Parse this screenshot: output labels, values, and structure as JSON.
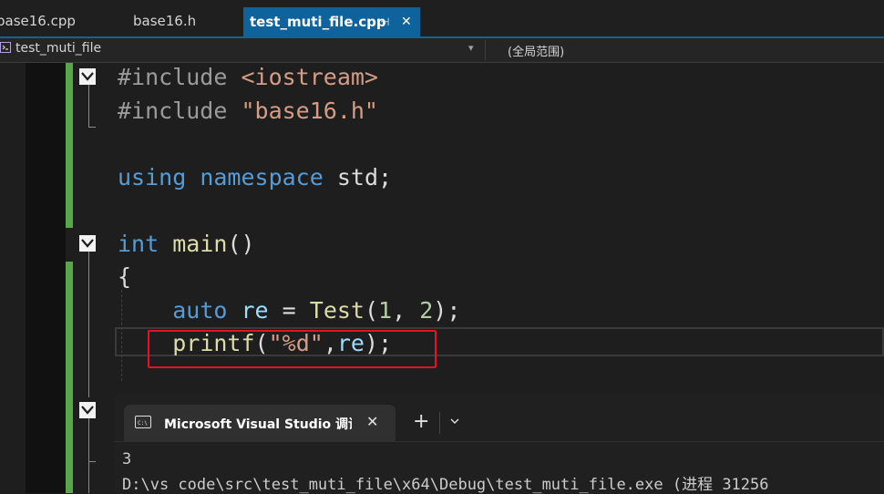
{
  "tabs": [
    {
      "label": "base16.cpp",
      "active": false
    },
    {
      "label": "base16.h",
      "active": false
    },
    {
      "label": "test_muti_file.cpp",
      "active": true
    }
  ],
  "active_tab_pin_icon": "pin-icon",
  "active_tab_close": "✕",
  "navbar": {
    "scope": "test_muti_file",
    "global_scope": "(全局范围)"
  },
  "code_lines": [
    {
      "tokens": [
        {
          "t": "#include ",
          "c": "pp"
        },
        {
          "t": "<iostream>",
          "c": "str"
        }
      ]
    },
    {
      "tokens": [
        {
          "t": "#include ",
          "c": "pp"
        },
        {
          "t": "\"base16.h\"",
          "c": "str"
        }
      ]
    },
    {
      "tokens": []
    },
    {
      "tokens": [
        {
          "t": "using",
          "c": "kw"
        },
        {
          "t": " ",
          "c": "pl"
        },
        {
          "t": "namespace",
          "c": "kw"
        },
        {
          "t": " std;",
          "c": "pl"
        }
      ]
    },
    {
      "tokens": []
    },
    {
      "tokens": [
        {
          "t": "int",
          "c": "kw"
        },
        {
          "t": " ",
          "c": "pl"
        },
        {
          "t": "main",
          "c": "fn"
        },
        {
          "t": "()",
          "c": "pl"
        }
      ]
    },
    {
      "tokens": [
        {
          "t": "{",
          "c": "pl"
        }
      ]
    },
    {
      "tokens": [
        {
          "t": "    ",
          "c": "pl"
        },
        {
          "t": "auto",
          "c": "kw"
        },
        {
          "t": " ",
          "c": "pl"
        },
        {
          "t": "re",
          "c": "id"
        },
        {
          "t": " = ",
          "c": "pl"
        },
        {
          "t": "Test",
          "c": "fn"
        },
        {
          "t": "(",
          "c": "pl"
        },
        {
          "t": "1",
          "c": "num"
        },
        {
          "t": ", ",
          "c": "pl"
        },
        {
          "t": "2",
          "c": "num"
        },
        {
          "t": ");",
          "c": "pl"
        }
      ]
    },
    {
      "tokens": [
        {
          "t": "    ",
          "c": "pl"
        },
        {
          "t": "printf",
          "c": "fn"
        },
        {
          "t": "(",
          "c": "pl"
        },
        {
          "t": "\"%d\"",
          "c": "str"
        },
        {
          "t": ",",
          "c": "pl"
        },
        {
          "t": "re",
          "c": "id"
        },
        {
          "t": ");",
          "c": "pl"
        }
      ]
    }
  ],
  "terminal": {
    "title": "Microsoft Visual Studio 调试控制台",
    "close": "✕",
    "add": "+",
    "output": [
      "3",
      "D:\\vs code\\src\\test_muti_file\\x64\\Debug\\test_muti_file.exe (进程 31256"
    ]
  },
  "colors": {
    "accent": "#0e639c",
    "change_bar": "#57a64a",
    "highlight_box": "#e81123",
    "keyword": "#569cd6",
    "string": "#d69d85",
    "function": "#dcdcaa"
  }
}
